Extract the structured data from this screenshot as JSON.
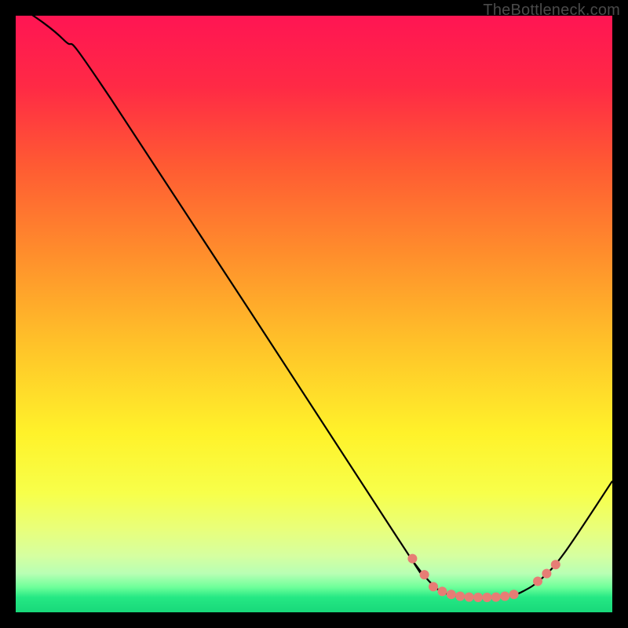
{
  "attribution": "TheBottleneck.com",
  "chart_data": {
    "type": "line",
    "title": "",
    "xlabel": "",
    "ylabel": "",
    "xlim": [
      0,
      100
    ],
    "ylim": [
      0,
      100
    ],
    "curve": [
      {
        "x": 0,
        "y": 102
      },
      {
        "x": 8,
        "y": 96
      },
      {
        "x": 16,
        "y": 86
      },
      {
        "x": 63,
        "y": 14
      },
      {
        "x": 67,
        "y": 8
      },
      {
        "x": 70,
        "y": 4.5
      },
      {
        "x": 72,
        "y": 3.2
      },
      {
        "x": 75,
        "y": 2.6
      },
      {
        "x": 80,
        "y": 2.5
      },
      {
        "x": 83,
        "y": 2.8
      },
      {
        "x": 85,
        "y": 3.5
      },
      {
        "x": 88,
        "y": 5.5
      },
      {
        "x": 92,
        "y": 10
      },
      {
        "x": 100,
        "y": 22
      }
    ],
    "dots": [
      {
        "x": 66.5,
        "y": 9.0
      },
      {
        "x": 68.5,
        "y": 6.3
      },
      {
        "x": 70.0,
        "y": 4.3
      },
      {
        "x": 71.5,
        "y": 3.5
      },
      {
        "x": 73.0,
        "y": 3.0
      },
      {
        "x": 74.5,
        "y": 2.7
      },
      {
        "x": 76.0,
        "y": 2.55
      },
      {
        "x": 77.5,
        "y": 2.5
      },
      {
        "x": 79.0,
        "y": 2.5
      },
      {
        "x": 80.5,
        "y": 2.55
      },
      {
        "x": 82.0,
        "y": 2.7
      },
      {
        "x": 83.5,
        "y": 3.0
      },
      {
        "x": 87.5,
        "y": 5.2
      },
      {
        "x": 89.0,
        "y": 6.5
      },
      {
        "x": 90.5,
        "y": 8.0
      }
    ],
    "gradient_stops": [
      {
        "offset": 0.0,
        "color": "#ff1553"
      },
      {
        "offset": 0.12,
        "color": "#ff2a45"
      },
      {
        "offset": 0.25,
        "color": "#ff5a33"
      },
      {
        "offset": 0.4,
        "color": "#ff8e2c"
      },
      {
        "offset": 0.55,
        "color": "#ffc229"
      },
      {
        "offset": 0.7,
        "color": "#fff22a"
      },
      {
        "offset": 0.8,
        "color": "#f7ff4a"
      },
      {
        "offset": 0.86,
        "color": "#e9ff7a"
      },
      {
        "offset": 0.905,
        "color": "#d6ffa0"
      },
      {
        "offset": 0.935,
        "color": "#b8ffb4"
      },
      {
        "offset": 0.958,
        "color": "#6eff9a"
      },
      {
        "offset": 0.975,
        "color": "#25e884"
      },
      {
        "offset": 1.0,
        "color": "#18d87a"
      }
    ],
    "curve_color": "#000000",
    "dot_color": "#e77d75",
    "dot_radius": 6
  }
}
